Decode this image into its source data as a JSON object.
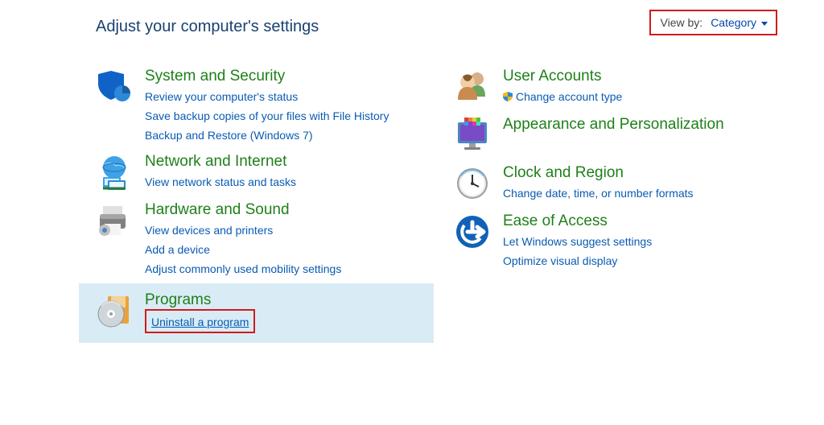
{
  "page_title": "Adjust your computer's settings",
  "view_by": {
    "label": "View by:",
    "value": "Category"
  },
  "categories": {
    "system_security": {
      "title": "System and Security",
      "links": {
        "review": "Review your computer's status",
        "backup": "Save backup copies of your files with File History",
        "restore": "Backup and Restore (Windows 7)"
      }
    },
    "network": {
      "title": "Network and Internet",
      "links": {
        "status": "View network status and tasks"
      }
    },
    "hardware": {
      "title": "Hardware and Sound",
      "links": {
        "devices": "View devices and printers",
        "adddev": "Add a device",
        "mobility": "Adjust commonly used mobility settings"
      }
    },
    "programs": {
      "title": "Programs",
      "links": {
        "uninstall": "Uninstall a program"
      }
    },
    "user_accounts": {
      "title": "User Accounts",
      "links": {
        "change_type": "Change account type"
      }
    },
    "appearance": {
      "title": "Appearance and Personalization"
    },
    "clock": {
      "title": "Clock and Region",
      "links": {
        "change": "Change date, time, or number formats"
      }
    },
    "ease": {
      "title": "Ease of Access",
      "links": {
        "suggest": "Let Windows suggest settings",
        "optimize": "Optimize visual display"
      }
    }
  }
}
